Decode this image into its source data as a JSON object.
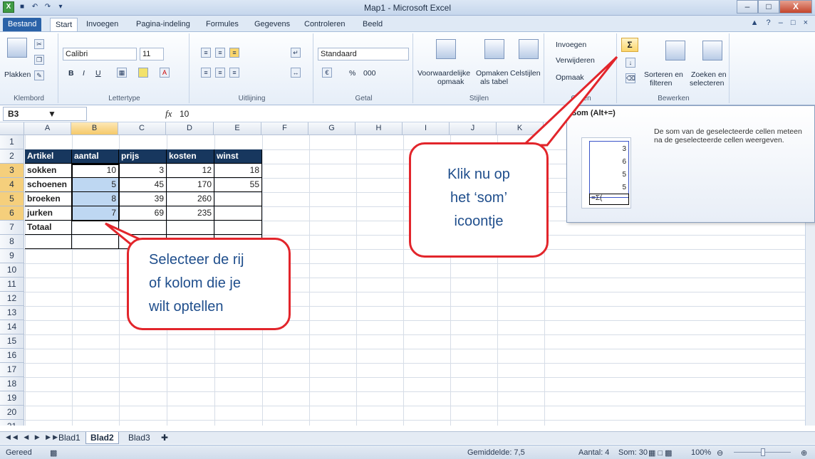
{
  "window": {
    "title": "Map1 - Microsoft Excel",
    "app_icon": "X",
    "controls": [
      "–",
      "□",
      "X"
    ]
  },
  "qat": [
    "save-icon",
    "undo-icon",
    "redo-icon"
  ],
  "tabs": {
    "file": "Bestand",
    "items": [
      "Start",
      "Invoegen",
      "Pagina-indeling",
      "Formules",
      "Gegevens",
      "Controleren",
      "Beeld"
    ]
  },
  "ribbon": {
    "clipboard": {
      "paste": "Plakken",
      "label": "Klembord"
    },
    "font": {
      "name": "Calibri",
      "size": "11",
      "label": "Lettertype",
      "bold": "B",
      "italic": "I",
      "underline": "U"
    },
    "align": {
      "label": "Uitlijning"
    },
    "number": {
      "format": "Standaard",
      "percent": "%",
      "thousands": "000",
      "label": "Getal"
    },
    "styles": {
      "cond": "Voorwaardelijke",
      "cond2": "opmaak",
      "table": "Opmaken",
      "table2": "als tabel",
      "cell": "Celstijlen",
      "label": "Stijlen"
    },
    "cells": {
      "insert": "Invoegen",
      "delete": "Verwijderen",
      "format": "Opmaak",
      "label": "Cellen"
    },
    "edit": {
      "sum": "Σ",
      "sort1": "Sorteren en",
      "sort2": "filteren",
      "find1": "Zoeken en",
      "find2": "selecteren",
      "label": "Bewerken"
    }
  },
  "formula": {
    "cell": "B3",
    "fx": "fx",
    "value": "10"
  },
  "columns": [
    "A",
    "B",
    "C",
    "D",
    "E",
    "F",
    "G",
    "H",
    "I",
    "J",
    "K"
  ],
  "rows": [
    "1",
    "2",
    "3",
    "4",
    "5",
    "6",
    "7",
    "8",
    "9",
    "10",
    "11",
    "12",
    "13",
    "14",
    "15",
    "16",
    "17",
    "18",
    "19",
    "20",
    "21"
  ],
  "table": {
    "headers": [
      "Artikel",
      "aantal",
      "prijs",
      "kosten",
      "winst"
    ],
    "rows": [
      [
        "sokken",
        "10",
        "3",
        "12",
        "18"
      ],
      [
        "schoenen",
        "5",
        "45",
        "170",
        "55"
      ],
      [
        "broeken",
        "8",
        "39",
        "260",
        ""
      ],
      [
        "jurken",
        "7",
        "69",
        "235",
        ""
      ]
    ],
    "total_label": "Totaal"
  },
  "tooltip": {
    "title": "Som (Alt+=)",
    "desc": "De som van de geselecteerde cellen meteen na de geselecteerde cellen weergeven.",
    "nums": [
      "3",
      "6",
      "5",
      "5"
    ],
    "formula": "=Σ("
  },
  "callouts": {
    "right": [
      "Klik nu op",
      "het ‘som’",
      "icoontje"
    ],
    "left": [
      "Selecteer de rij",
      "of kolom die je",
      "wilt optellen"
    ]
  },
  "sheets": [
    "Blad1",
    "Blad2",
    "Blad3"
  ],
  "status": {
    "ready": "Gereed",
    "avg": "Gemiddelde: 7,5",
    "count": "Aantal: 4",
    "sum": "Som: 30",
    "zoom": "100%"
  },
  "colors": {
    "header_fill": "#17375e",
    "selection": "#bed7f2",
    "callout_border": "#e2252b"
  }
}
